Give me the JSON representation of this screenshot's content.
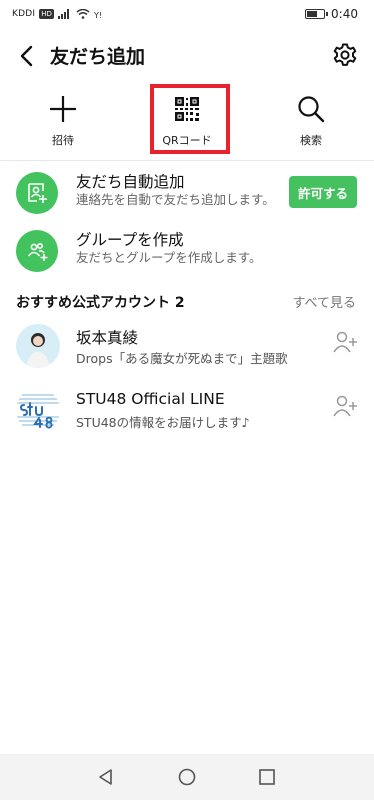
{
  "status_bar": {
    "carrier": "KDDI",
    "hd_badge": "HD",
    "time": "0:40",
    "battery_level": 0.55
  },
  "header": {
    "title": "友だち追加",
    "back_icon": "chevron-left-icon",
    "settings_icon": "gear-icon"
  },
  "actions": [
    {
      "label": "招待",
      "icon": "plus-icon"
    },
    {
      "label": "QRコード",
      "icon": "qr-code-icon",
      "highlighted": true
    },
    {
      "label": "検索",
      "icon": "search-icon"
    }
  ],
  "highlight_color": "#e8232d",
  "rows": [
    {
      "title": "友だち自動追加",
      "subtitle": "連絡先を自動で友だち追加します。",
      "icon": "add-contact-icon",
      "button_label": "許可する"
    },
    {
      "title": "グループを作成",
      "subtitle": "友だちとグループを作成します。",
      "icon": "group-add-icon"
    }
  ],
  "accent_green": "#45c25f",
  "recommended": {
    "title": "おすすめ公式アカウント 2",
    "see_all": "すべて見る",
    "accounts": [
      {
        "name": "坂本真綾",
        "description": "Drops「ある魔女が死ぬまで」主題歌",
        "icon": "add-friend-icon"
      },
      {
        "name": "STU48 Official LINE",
        "description": "STU48の情報をお届けします♪",
        "icon": "add-friend-icon",
        "logo_text": "STU48"
      }
    ]
  },
  "nav": {
    "back": "triangle-back-icon",
    "home": "circle-home-icon",
    "recents": "square-recents-icon"
  }
}
